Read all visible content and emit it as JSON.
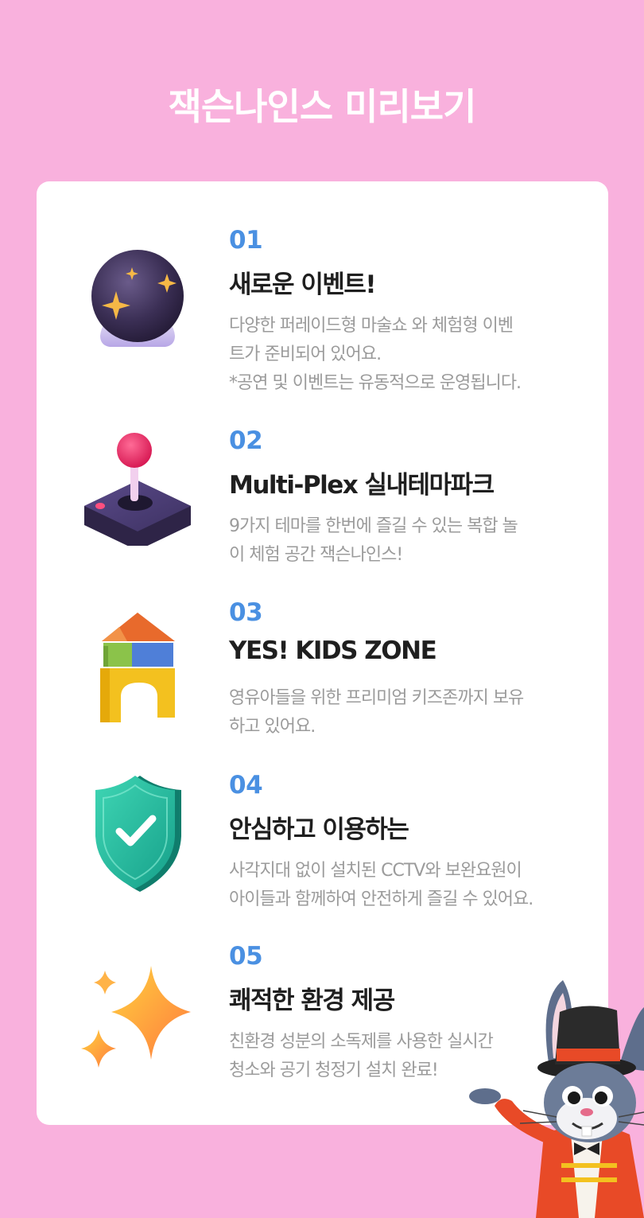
{
  "header": {
    "title": "잭슨나인스 미리보기"
  },
  "features": [
    {
      "num": "01",
      "title": "새로운 이벤트!",
      "desc": "다양한 퍼레이드형 마술쇼 와 체험형 이벤\n트가 준비되어 있어요.\n*공연 및 이벤트는 유동적으로 운영됩니다.",
      "icon": "crystal-ball-icon"
    },
    {
      "num": "02",
      "title": "Multi-Plex 실내테마파크",
      "desc": "9가지 테마를 한번에 즐길 수 있는 복합 놀\n이 체험 공간 잭슨나인스!",
      "icon": "joystick-icon"
    },
    {
      "num": "03",
      "title": "YES! KIDS ZONE",
      "desc": "영유아들을 위한 프리미엄 키즈존까지 보유\n하고 있어요.",
      "icon": "toy-blocks-icon"
    },
    {
      "num": "04",
      "title": "안심하고 이용하는",
      "desc": "사각지대 없이 설치된 CCTV와 보완요원이\n아이들과 함께하여 안전하게 즐길 수 있어요.",
      "icon": "shield-check-icon"
    },
    {
      "num": "05",
      "title": "쾌적한 환경 제공",
      "desc": "친환경 성분의 소독제를 사용한 실시간\n청소와 공기 청정기 설치 완료!",
      "icon": "sparkles-icon"
    }
  ],
  "mascot": {
    "icon": "rabbit-magician-mascot"
  },
  "colors": {
    "background": "#f9b1dd",
    "card": "#ffffff",
    "number_accent": "#4a90e2",
    "title_text": "#1f1f1f",
    "desc_text": "#9b9b9b"
  }
}
